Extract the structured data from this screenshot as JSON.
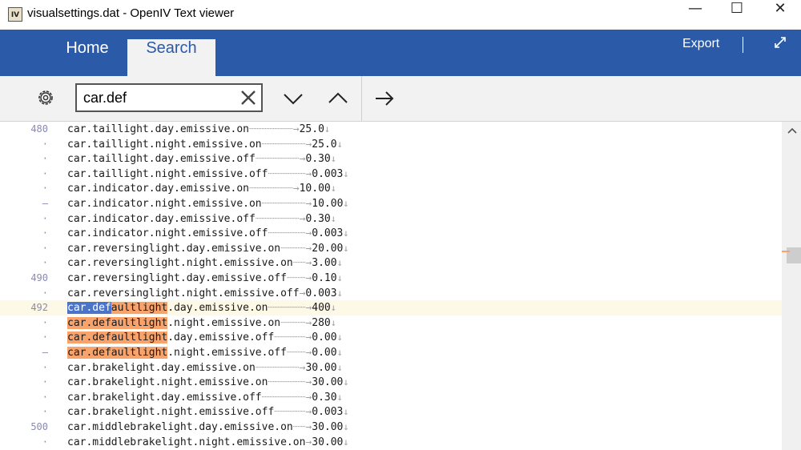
{
  "window": {
    "title": "visualsettings.dat - OpenIV Text viewer",
    "app_icon_text": "IV",
    "minimize_glyph": "—",
    "maximize_glyph": "☐",
    "close_glyph": "✕"
  },
  "ribbon": {
    "tabs": [
      {
        "label": "Home",
        "active": false
      },
      {
        "label": "Search",
        "active": true
      }
    ],
    "export_label": "Export"
  },
  "toolbar": {
    "search_value": "car.def"
  },
  "editor": {
    "current_line": 492,
    "match_prefix": "car.def",
    "match_term": "car.defaultlight",
    "lines": [
      {
        "num": "480",
        "key": "car.taillight.day.emissive.on",
        "value": "25.0"
      },
      {
        "num": "·",
        "key": "car.taillight.night.emissive.on",
        "value": "25.0"
      },
      {
        "num": "·",
        "key": "car.taillight.day.emissive.off",
        "value": "0.30"
      },
      {
        "num": "·",
        "key": "car.taillight.night.emissive.off",
        "value": "0.003"
      },
      {
        "num": "·",
        "key": "car.indicator.day.emissive.on",
        "value": "10.00"
      },
      {
        "num": "–",
        "key": "car.indicator.night.emissive.on",
        "value": "10.00"
      },
      {
        "num": "·",
        "key": "car.indicator.day.emissive.off",
        "value": "0.30"
      },
      {
        "num": "·",
        "key": "car.indicator.night.emissive.off",
        "value": "0.003"
      },
      {
        "num": "·",
        "key": "car.reversinglight.day.emissive.on",
        "value": "20.00"
      },
      {
        "num": "·",
        "key": "car.reversinglight.night.emissive.on",
        "value": "3.00"
      },
      {
        "num": "490",
        "key": "car.reversinglight.day.emissive.off",
        "value": "0.10"
      },
      {
        "num": "·",
        "key": "car.reversinglight.night.emissive.off",
        "value": "0.003"
      },
      {
        "num": "492",
        "key": "car.defaultlight.day.emissive.on",
        "value": "400"
      },
      {
        "num": "·",
        "key": "car.defaultlight.night.emissive.on",
        "value": "280"
      },
      {
        "num": "·",
        "key": "car.defaultlight.day.emissive.off",
        "value": "0.00"
      },
      {
        "num": "–",
        "key": "car.defaultlight.night.emissive.off",
        "value": "0.00"
      },
      {
        "num": "·",
        "key": "car.brakelight.day.emissive.on",
        "value": "30.00"
      },
      {
        "num": "·",
        "key": "car.brakelight.night.emissive.on",
        "value": "30.00"
      },
      {
        "num": "·",
        "key": "car.brakelight.day.emissive.off",
        "value": "0.30"
      },
      {
        "num": "·",
        "key": "car.brakelight.night.emissive.off",
        "value": "0.003"
      },
      {
        "num": "500",
        "key": "car.middlebrakelight.day.emissive.on",
        "value": "30.00"
      },
      {
        "num": "·",
        "key": "car.middlebrakelight.night.emissive.on",
        "value": "30.00"
      }
    ]
  },
  "colors": {
    "ribbon": "#2b5aa8",
    "match_highlight": "#f7a36b",
    "selection": "#4a74c9",
    "current_line": "#fdf9e6"
  }
}
